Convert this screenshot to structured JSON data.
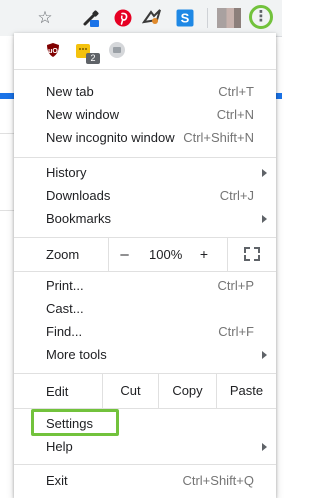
{
  "toolbar": {
    "icons": [
      "star-icon",
      "eyedropper-extension-icon",
      "pinterest-extension-icon",
      "vt-extension-icon",
      "s-extension-icon"
    ],
    "s_icon_letter": "S",
    "menu_glyph": "⋮",
    "highlight_color": "#72c23c"
  },
  "extensions": {
    "icons": [
      "ublock-icon",
      "sticky-notes-icon",
      "gray-extension-icon"
    ],
    "notes_badge": "2"
  },
  "menu": {
    "new_tab": {
      "label": "New tab",
      "shortcut": "Ctrl+T"
    },
    "new_window": {
      "label": "New window",
      "shortcut": "Ctrl+N"
    },
    "new_incognito": {
      "label": "New incognito window",
      "shortcut": "Ctrl+Shift+N"
    },
    "history": {
      "label": "History"
    },
    "downloads": {
      "label": "Downloads",
      "shortcut": "Ctrl+J"
    },
    "bookmarks": {
      "label": "Bookmarks"
    },
    "zoom": {
      "label": "Zoom",
      "minus": "–",
      "value": "100%",
      "plus": "+"
    },
    "print": {
      "label": "Print...",
      "shortcut": "Ctrl+P"
    },
    "cast": {
      "label": "Cast..."
    },
    "find": {
      "label": "Find...",
      "shortcut": "Ctrl+F"
    },
    "more_tools": {
      "label": "More tools"
    },
    "edit": {
      "label": "Edit",
      "cut": "Cut",
      "copy": "Copy",
      "paste": "Paste"
    },
    "settings": {
      "label": "Settings"
    },
    "help": {
      "label": "Help"
    },
    "exit": {
      "label": "Exit",
      "shortcut": "Ctrl+Shift+Q"
    }
  }
}
